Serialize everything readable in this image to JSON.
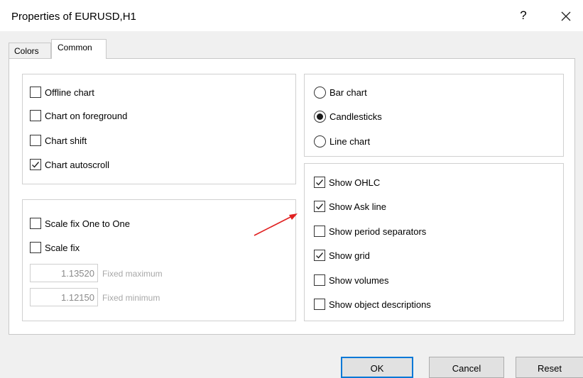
{
  "dialog": {
    "title": "Properties of EURUSD,H1",
    "help_label": "?"
  },
  "tabs": [
    {
      "label": "Colors",
      "active": false
    },
    {
      "label": "Common",
      "active": true
    }
  ],
  "chart_options": {
    "offline_chart": {
      "label": "Offline chart",
      "checked": false
    },
    "chart_on_foreground": {
      "label": "Chart on foreground",
      "checked": false
    },
    "chart_shift": {
      "label": "Chart shift",
      "checked": false
    },
    "chart_autoscroll": {
      "label": "Chart autoscroll",
      "checked": true
    }
  },
  "scale": {
    "scale_fix_one_to_one": {
      "label": "Scale fix One to One",
      "checked": false
    },
    "scale_fix": {
      "label": "Scale fix",
      "checked": false
    },
    "fixed_maximum": {
      "value": "1.13520",
      "label": "Fixed maximum"
    },
    "fixed_minimum": {
      "value": "1.12150",
      "label": "Fixed minimum"
    }
  },
  "chart_type": {
    "selected": "candlesticks",
    "bar_chart": {
      "label": "Bar chart"
    },
    "candlesticks": {
      "label": "Candlesticks"
    },
    "line_chart": {
      "label": "Line chart"
    }
  },
  "show_options": {
    "show_ohlc": {
      "label": "Show OHLC",
      "checked": true
    },
    "show_ask_line": {
      "label": "Show Ask line",
      "checked": true
    },
    "show_period_separators": {
      "label": "Show period separators",
      "checked": false
    },
    "show_grid": {
      "label": "Show grid",
      "checked": true
    },
    "show_volumes": {
      "label": "Show volumes",
      "checked": false
    },
    "show_object_descriptions": {
      "label": "Show object descriptions",
      "checked": false
    }
  },
  "buttons": {
    "ok": "OK",
    "cancel": "Cancel",
    "reset": "Reset"
  },
  "colors": {
    "accent": "#0078d7",
    "arrow": "#e02020"
  },
  "icons": {
    "close": "close-icon",
    "check": "check-icon",
    "arrow": "arrow-annotation-icon"
  }
}
